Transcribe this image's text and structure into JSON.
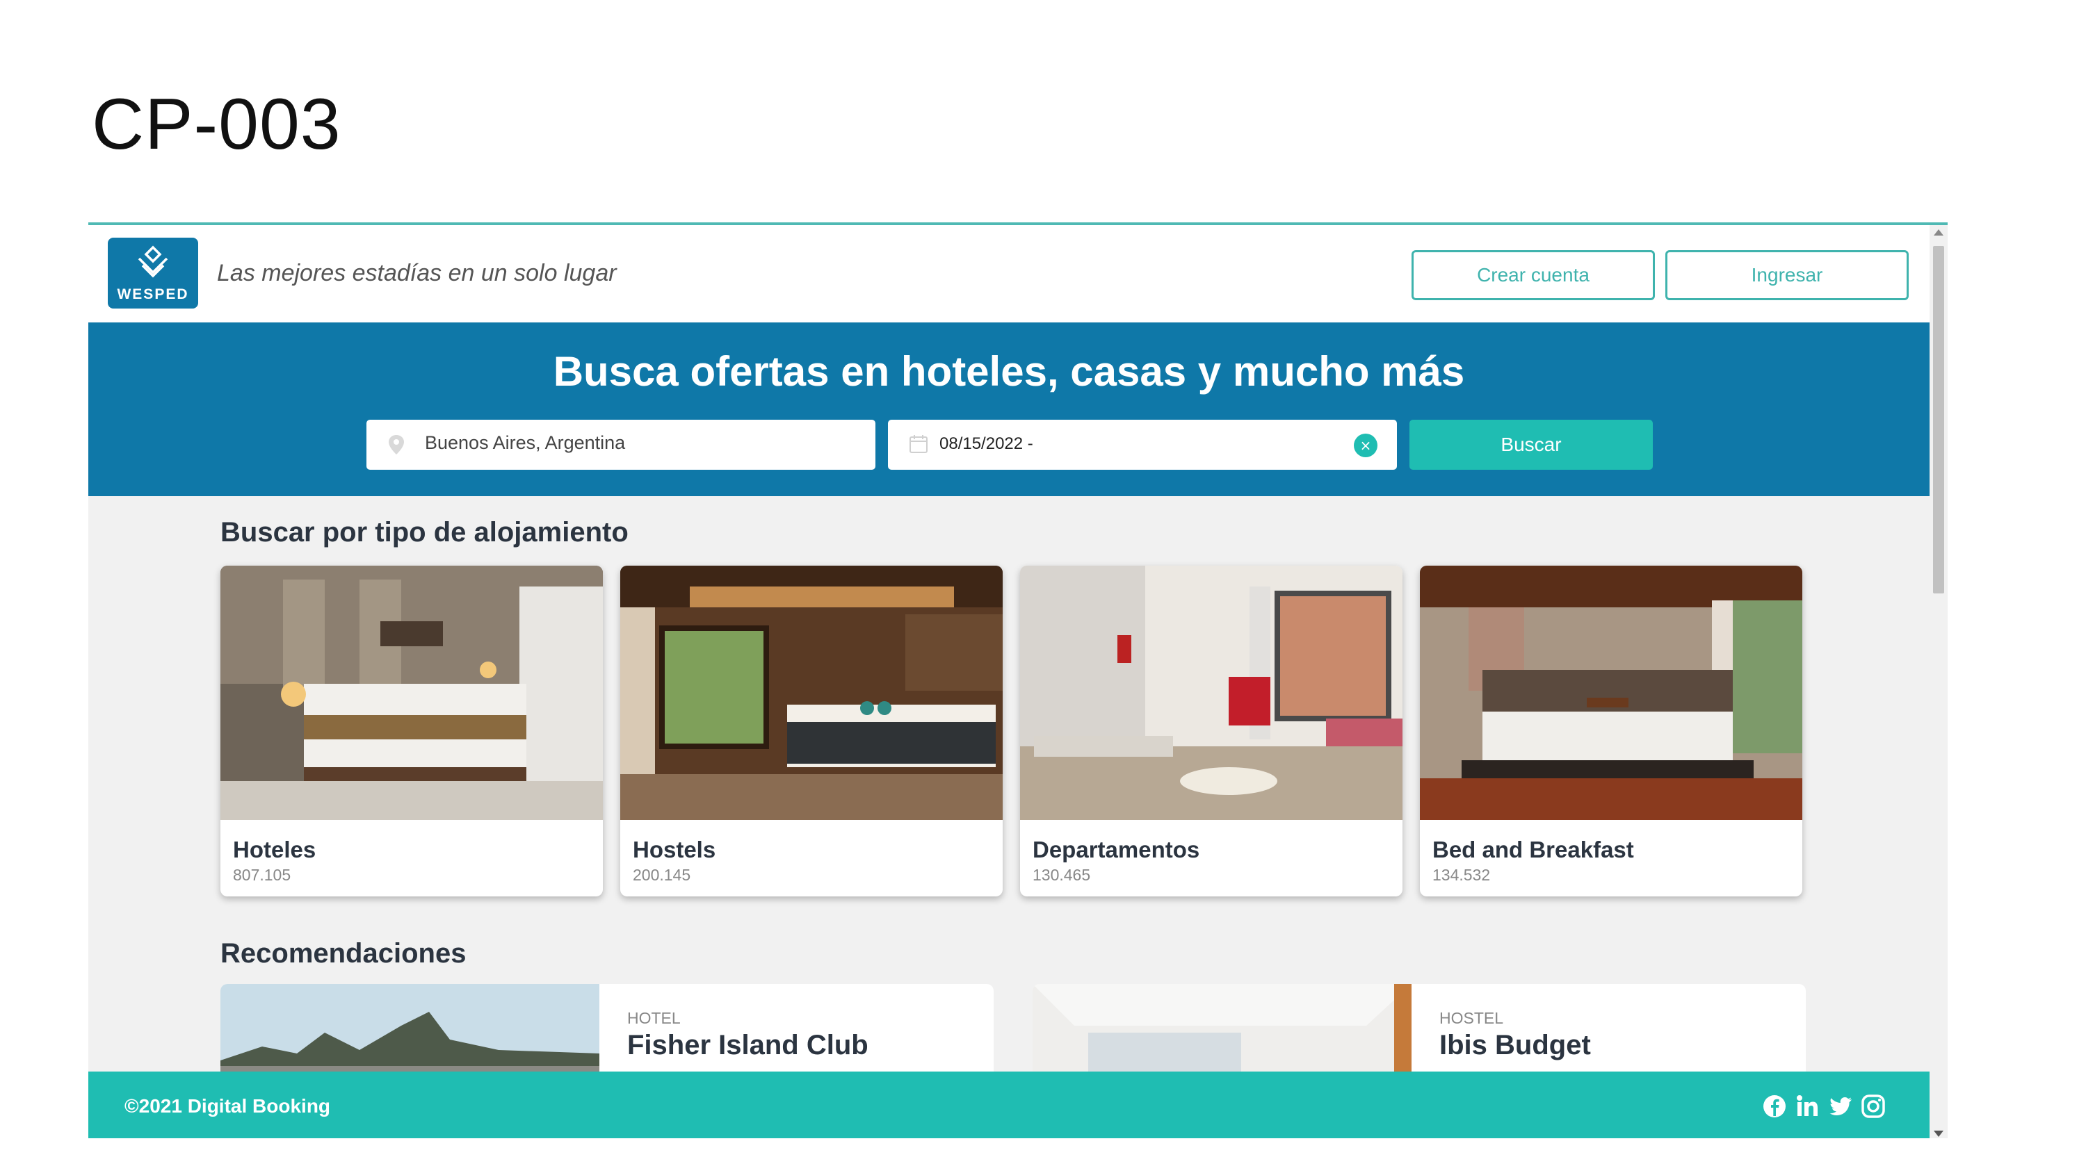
{
  "slide": {
    "title": "CP-003"
  },
  "header": {
    "logo_text": "WESPED",
    "tagline": "Las mejores estadías en un solo lugar",
    "create_account": "Crear cuenta",
    "login": "Ingresar"
  },
  "hero": {
    "title": "Busca ofertas en hoteles, casas y mucho más",
    "location_value": "Buenos Aires, Argentina",
    "date_value": "08/15/2022 -",
    "clear_symbol": "×",
    "search_button": "Buscar"
  },
  "categories_section": {
    "title": "Buscar por tipo de alojamiento",
    "items": [
      {
        "name": "Hoteles",
        "count": "807.105"
      },
      {
        "name": "Hostels",
        "count": "200.145"
      },
      {
        "name": "Departamentos",
        "count": "130.465"
      },
      {
        "name": "Bed and Breakfast",
        "count": "134.532"
      }
    ]
  },
  "recommendations_section": {
    "title": "Recomendaciones",
    "items": [
      {
        "category": "HOTEL",
        "name": "Fisher Island Club"
      },
      {
        "category": "HOSTEL",
        "name": "Ibis Budget"
      }
    ]
  },
  "footer": {
    "copyright": "©2021 Digital Booking",
    "social_icons": [
      "facebook-icon",
      "linkedin-icon",
      "twitter-icon",
      "instagram-icon"
    ]
  },
  "colors": {
    "primary_blue": "#0f78a8",
    "accent_teal": "#1fbdb2",
    "text_dark": "#2b3440"
  }
}
